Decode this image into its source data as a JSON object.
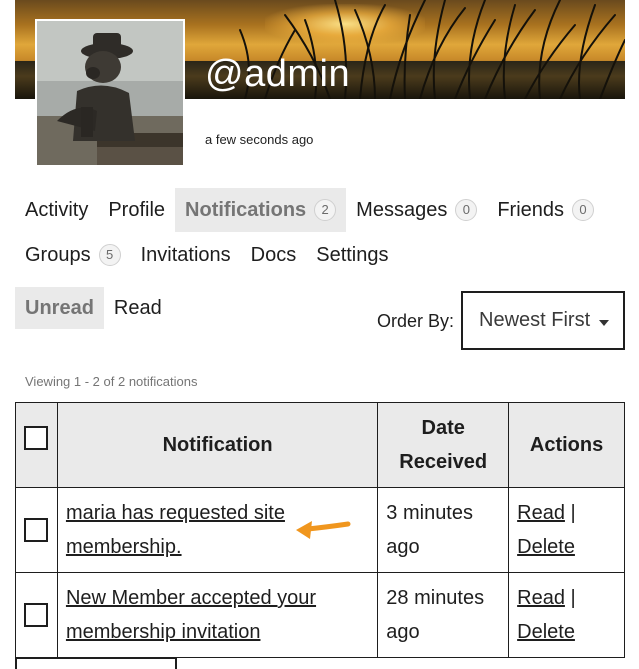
{
  "profile": {
    "display_name": "@admin",
    "last_active": "a few seconds ago"
  },
  "primary_nav": [
    {
      "label": "Activity"
    },
    {
      "label": "Profile"
    },
    {
      "label": "Notifications",
      "count": "2",
      "current": true
    },
    {
      "label": "Messages",
      "count": "0"
    },
    {
      "label": "Friends",
      "count": "0"
    },
    {
      "label": "Groups",
      "count": "5"
    },
    {
      "label": "Invitations"
    },
    {
      "label": "Docs"
    },
    {
      "label": "Settings"
    }
  ],
  "sub_nav": [
    {
      "label": "Unread",
      "current": true
    },
    {
      "label": "Read"
    }
  ],
  "order_by": {
    "label": "Order By:",
    "selected": "Newest First"
  },
  "viewing_text": "Viewing 1 - 2 of 2 notifications",
  "table": {
    "headers": {
      "notification": "Notification",
      "date_line1": "Date",
      "date_line2": "Received",
      "actions": "Actions"
    },
    "rows": [
      {
        "text_line1": "maria has requested site",
        "text_line2": "membership.",
        "date_line1": "3 minutes",
        "date_line2": "ago",
        "read_label": "Read",
        "separator": "|",
        "delete_label": "Delete"
      },
      {
        "text_line1": "New Member accepted your",
        "text_line2": "membership invitation",
        "date_line1": "28 minutes",
        "date_line2": "ago",
        "read_label": "Read",
        "separator": "|",
        "delete_label": "Delete"
      }
    ]
  },
  "colors": {
    "accent_arrow": "#f0961e",
    "current_tab_bg": "#eaeaea"
  }
}
